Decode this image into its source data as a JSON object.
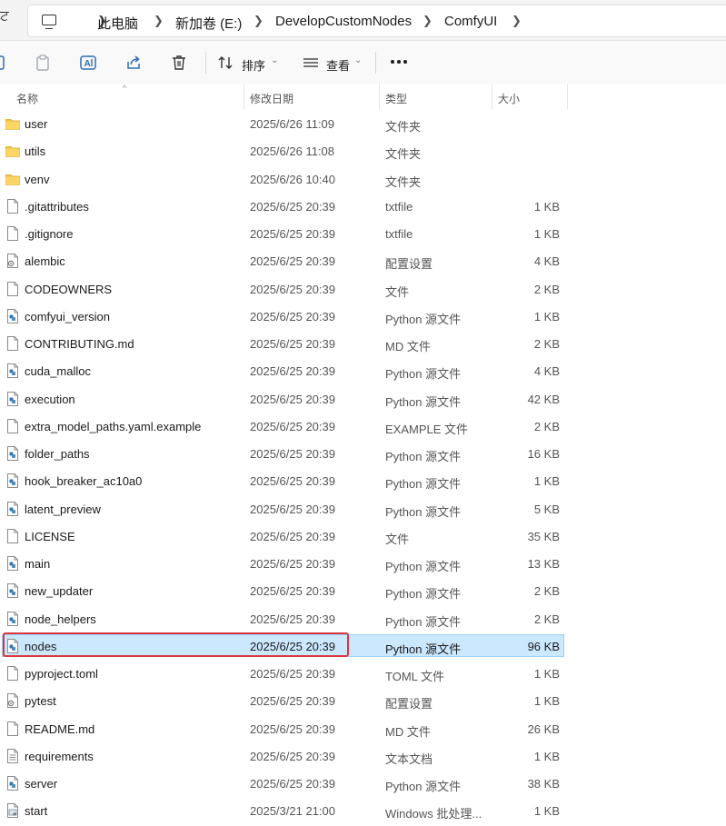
{
  "address_bar": {
    "left_glyph": "ਟ",
    "breadcrumbs": [
      "此电脑",
      "新加卷 (E:)",
      "DevelopCustomNodes",
      "ComfyUI"
    ]
  },
  "toolbar": {
    "sort_label": "排序",
    "view_label": "查看"
  },
  "columns": {
    "name": "名称",
    "date": "修改日期",
    "type": "类型",
    "size": "大小"
  },
  "files": [
    {
      "name": "user",
      "date": "2025/6/26 11:09",
      "type": "文件夹",
      "size": "",
      "icon": "folder"
    },
    {
      "name": "utils",
      "date": "2025/6/26 11:08",
      "type": "文件夹",
      "size": "",
      "icon": "folder"
    },
    {
      "name": "venv",
      "date": "2025/6/26 10:40",
      "type": "文件夹",
      "size": "",
      "icon": "folder"
    },
    {
      "name": ".gitattributes",
      "date": "2025/6/25 20:39",
      "type": "txtfile",
      "size": "1 KB",
      "icon": "doc"
    },
    {
      "name": ".gitignore",
      "date": "2025/6/25 20:39",
      "type": "txtfile",
      "size": "1 KB",
      "icon": "doc"
    },
    {
      "name": "alembic",
      "date": "2025/6/25 20:39",
      "type": "配置设置",
      "size": "4 KB",
      "icon": "config"
    },
    {
      "name": "CODEOWNERS",
      "date": "2025/6/25 20:39",
      "type": "文件",
      "size": "2 KB",
      "icon": "doc"
    },
    {
      "name": "comfyui_version",
      "date": "2025/6/25 20:39",
      "type": "Python 源文件",
      "size": "1 KB",
      "icon": "python"
    },
    {
      "name": "CONTRIBUTING.md",
      "date": "2025/6/25 20:39",
      "type": "MD 文件",
      "size": "2 KB",
      "icon": "doc"
    },
    {
      "name": "cuda_malloc",
      "date": "2025/6/25 20:39",
      "type": "Python 源文件",
      "size": "4 KB",
      "icon": "python"
    },
    {
      "name": "execution",
      "date": "2025/6/25 20:39",
      "type": "Python 源文件",
      "size": "42 KB",
      "icon": "python"
    },
    {
      "name": "extra_model_paths.yaml.example",
      "date": "2025/6/25 20:39",
      "type": "EXAMPLE 文件",
      "size": "2 KB",
      "icon": "doc"
    },
    {
      "name": "folder_paths",
      "date": "2025/6/25 20:39",
      "type": "Python 源文件",
      "size": "16 KB",
      "icon": "python"
    },
    {
      "name": "hook_breaker_ac10a0",
      "date": "2025/6/25 20:39",
      "type": "Python 源文件",
      "size": "1 KB",
      "icon": "python"
    },
    {
      "name": "latent_preview",
      "date": "2025/6/25 20:39",
      "type": "Python 源文件",
      "size": "5 KB",
      "icon": "python"
    },
    {
      "name": "LICENSE",
      "date": "2025/6/25 20:39",
      "type": "文件",
      "size": "35 KB",
      "icon": "doc"
    },
    {
      "name": "main",
      "date": "2025/6/25 20:39",
      "type": "Python 源文件",
      "size": "13 KB",
      "icon": "python"
    },
    {
      "name": "new_updater",
      "date": "2025/6/25 20:39",
      "type": "Python 源文件",
      "size": "2 KB",
      "icon": "python"
    },
    {
      "name": "node_helpers",
      "date": "2025/6/25 20:39",
      "type": "Python 源文件",
      "size": "2 KB",
      "icon": "python"
    },
    {
      "name": "nodes",
      "date": "2025/6/25 20:39",
      "type": "Python 源文件",
      "size": "96 KB",
      "icon": "python",
      "selected": true
    },
    {
      "name": "pyproject.toml",
      "date": "2025/6/25 20:39",
      "type": "TOML 文件",
      "size": "1 KB",
      "icon": "doc"
    },
    {
      "name": "pytest",
      "date": "2025/6/25 20:39",
      "type": "配置设置",
      "size": "1 KB",
      "icon": "config"
    },
    {
      "name": "README.md",
      "date": "2025/6/25 20:39",
      "type": "MD 文件",
      "size": "26 KB",
      "icon": "doc"
    },
    {
      "name": "requirements",
      "date": "2025/6/25 20:39",
      "type": "文本文档",
      "size": "1 KB",
      "icon": "text"
    },
    {
      "name": "server",
      "date": "2025/6/25 20:39",
      "type": "Python 源文件",
      "size": "38 KB",
      "icon": "python"
    },
    {
      "name": "start",
      "date": "2025/3/21 21:00",
      "type": "Windows 批处理...",
      "size": "1 KB",
      "icon": "batch"
    }
  ],
  "colors": {
    "selection": "#cce8ff",
    "selection_border": "#99d1ff",
    "highlight": "#d9363e",
    "folder": "#f4c343"
  }
}
